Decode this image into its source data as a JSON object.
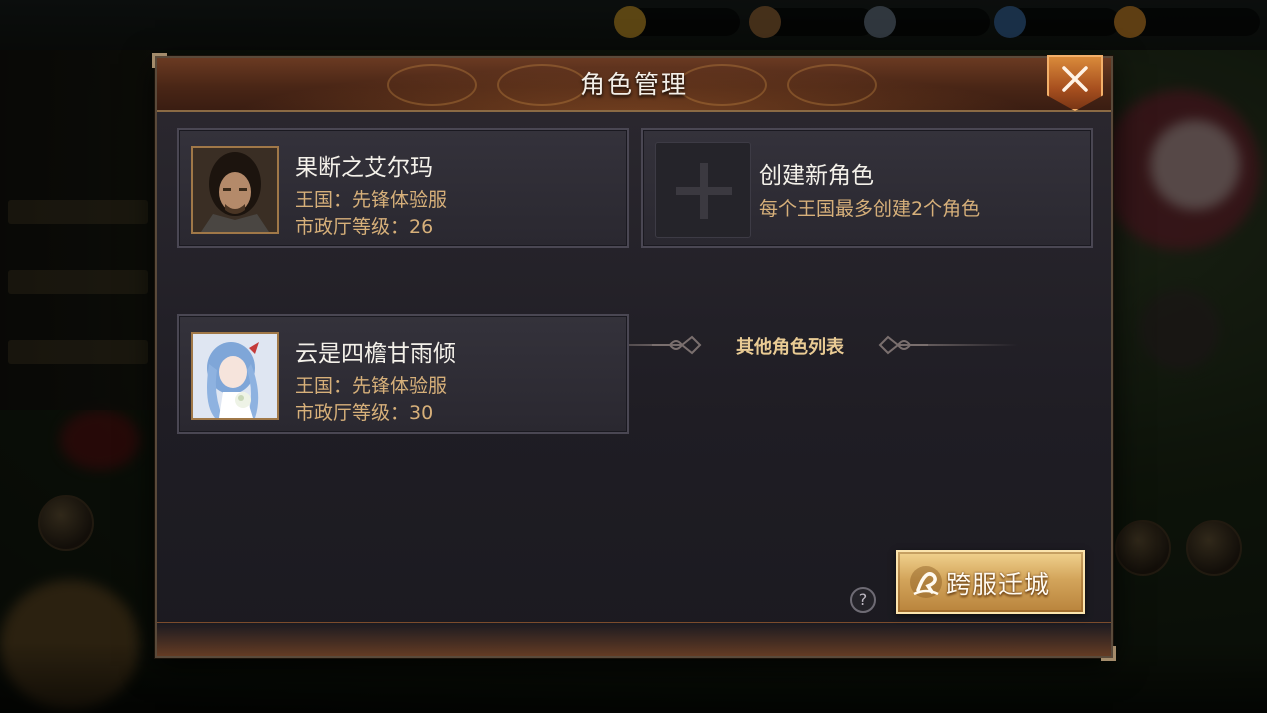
{
  "dialog": {
    "title": "角色管理"
  },
  "current_character": {
    "name": "果断之艾尔玛",
    "kingdom": "王国：先锋体验服",
    "town_hall_level": "市政厅等级：26"
  },
  "create_card": {
    "title": "创建新角色",
    "hint": "每个王国最多创建2个角色"
  },
  "section": {
    "other_characters_label": "其他角色列表"
  },
  "other_characters": [
    {
      "name": "云是四檐甘雨倾",
      "kingdom": "王国：先锋体验服",
      "town_hall_level": "市政厅等级：30"
    }
  ],
  "help": {
    "symbol": "?"
  },
  "migrate_button": {
    "label": "跨服迁城"
  },
  "colors": {
    "accent_gold": "#d7b07a",
    "button_gold": "#d3a55b",
    "close_orange": "#c06a2a"
  },
  "icons": [
    "close-icon",
    "plus-icon",
    "help-icon",
    "migrate-icon",
    "divider-ornament-icon"
  ]
}
